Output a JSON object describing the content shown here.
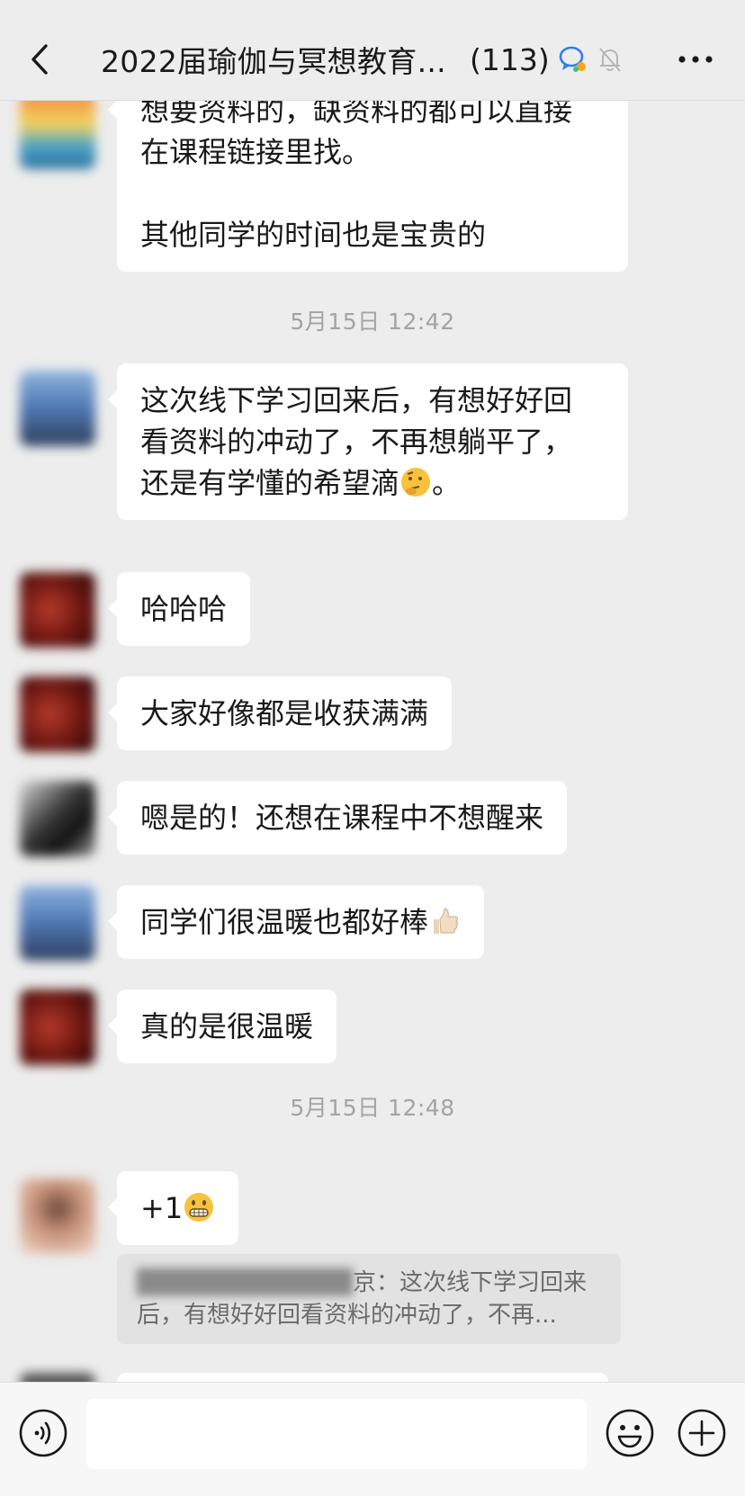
{
  "header": {
    "title": "2022届瑜伽与冥想教育...",
    "count": "(113)",
    "back_icon": "chevron-left-icon",
    "chat_icon": "group-chat-icon",
    "mute_icon": "bell-off-icon",
    "more_icon": "more-dots-icon"
  },
  "messages": [
    {
      "text": "想要资料的，缺资料的都可以直接\n在课程链接里找。\n\n其他同学的时间也是宝贵的"
    },
    {
      "timestamp": "5月15日 12:42"
    },
    {
      "text": "这次线下学习回来后，有想好好回\n看资料的冲动了，不再想躺平了，\n还是有学懂的希望滴",
      "emoji": "thinking-face",
      "suffix": "。"
    },
    {
      "text": "哈哈哈"
    },
    {
      "text": "大家好像都是收获满满"
    },
    {
      "text": "嗯是的！还想在课程中不想醒来"
    },
    {
      "text": "同学们很温暖也都好棒",
      "emoji": "thumbs-up"
    },
    {
      "text": "真的是很温暖"
    },
    {
      "timestamp": "5月15日 12:48"
    },
    {
      "text": "+1",
      "emoji": "grinning-face"
    },
    {
      "quote_visible": "京：这次线下学习回来",
      "quote_line2": "后，有想好好回看资料的冲动了，不再..."
    }
  ],
  "colors": {
    "background": "#ededed",
    "bubble": "#ffffff",
    "quote": "#e2e2e2",
    "timestamp": "#a3a3a3"
  },
  "bottom_bar": {
    "voice_icon": "voice-icon",
    "emoji_icon": "smiley-icon",
    "plus_icon": "plus-circle-icon"
  }
}
